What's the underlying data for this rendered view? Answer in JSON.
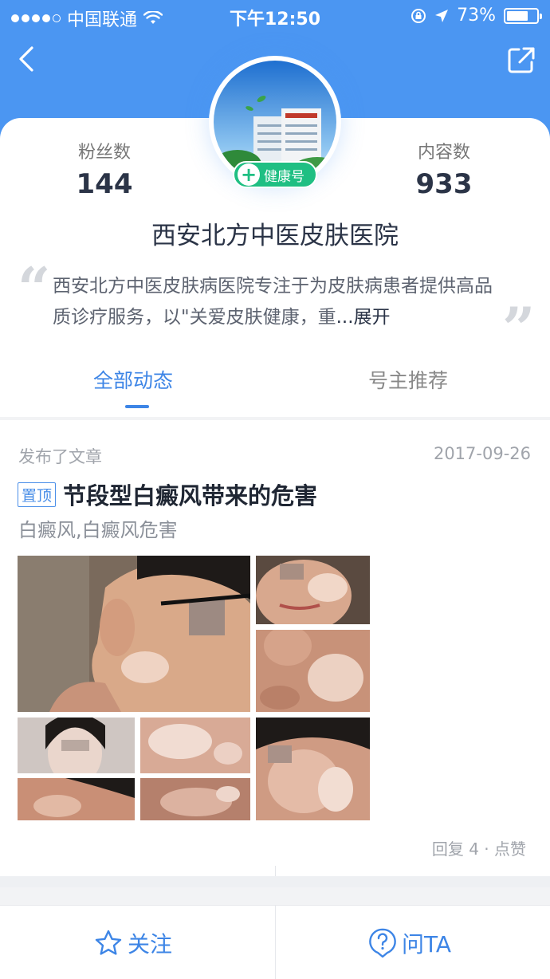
{
  "status_bar": {
    "carrier": "中国联通",
    "time": "下午12:50",
    "battery": "73%",
    "battery_level": 0.73,
    "signal_bars_filled": 4,
    "signal_bars_total": 5
  },
  "nav": {
    "back_icon": "chevron-left-icon",
    "share_icon": "external-share-icon"
  },
  "profile": {
    "fans_label": "粉丝数",
    "fans_count": "144",
    "content_label": "内容数",
    "content_count": "933",
    "badge_label": "健康号",
    "name": "西安北方中医皮肤医院",
    "description": "西安北方中医皮肤病医院专注于为皮肤病患者提供高品质诊疗服务，以\"关爱皮肤健康，重",
    "expand_label": "...展开"
  },
  "tabs": [
    {
      "label": "全部动态",
      "active": true
    },
    {
      "label": "号主推荐",
      "active": false
    }
  ],
  "article": {
    "action": "发布了文章",
    "date": "2017-09-26",
    "pin_label": "置顶",
    "title": "节段型白癜风带来的危害",
    "tags": "白癜风,白癜风危害",
    "stats": "回复 4 · 点赞"
  },
  "bottom_bar": {
    "follow_label": "关注",
    "ask_label": "问TA"
  },
  "colors": {
    "header_blue": "#4b96f2",
    "accent_blue": "#3d85e6",
    "badge_green": "#1fbf83"
  }
}
